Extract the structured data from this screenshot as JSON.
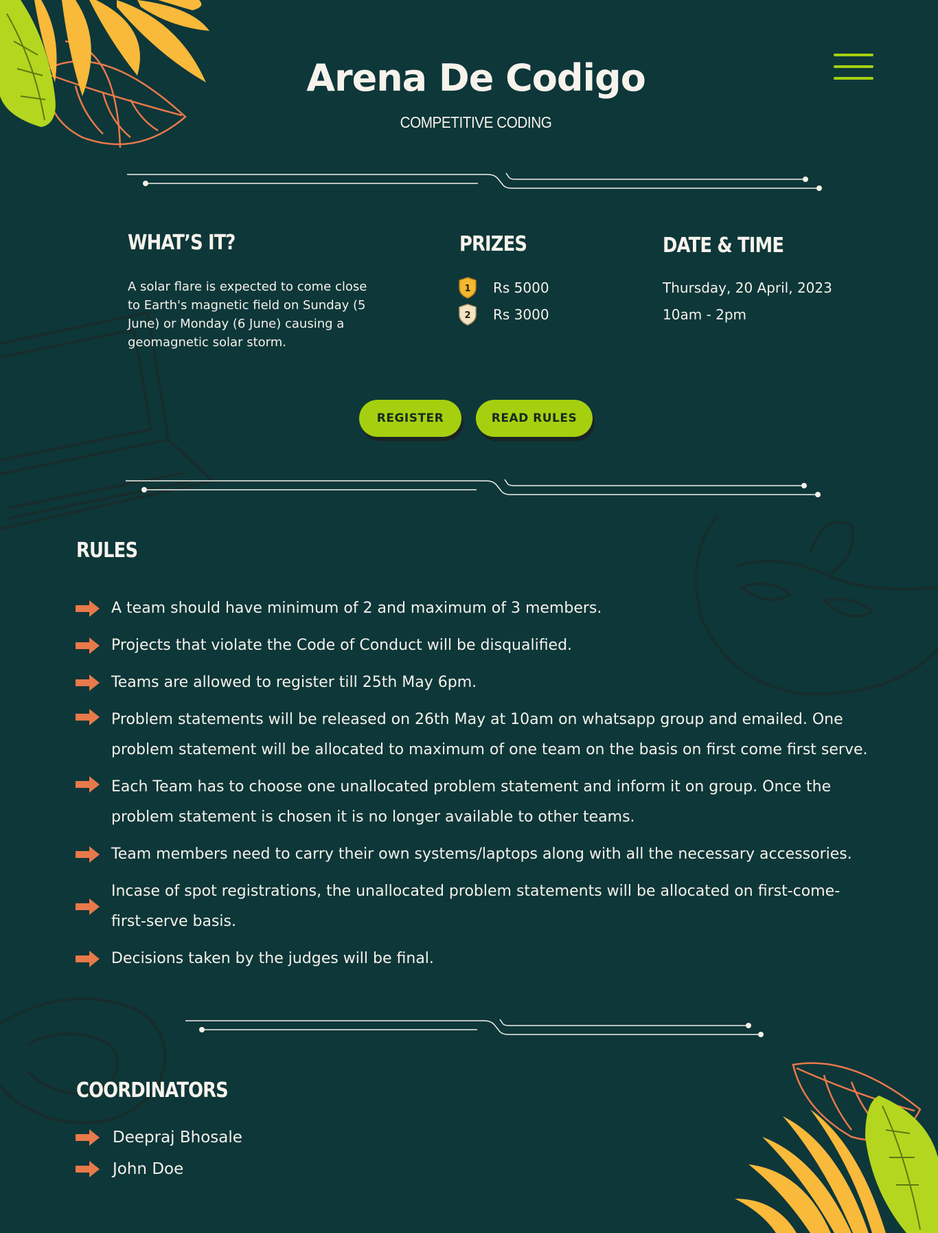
{
  "header": {
    "title": "Arena De Codigo",
    "subtitle": "COMPETITIVE CODING",
    "menu_icon": "hamburger-menu-icon"
  },
  "about": {
    "heading": "WHAT’S IT?",
    "text": "A solar flare is expected to come close to Earth's magnetic field on Sunday (5 June) or Monday (6 June) causing a geomagnetic solar storm."
  },
  "prizes": {
    "heading": "PRIZES",
    "items": [
      {
        "rank": "1",
        "amount": "Rs 5000",
        "badge_color": "#f5b731"
      },
      {
        "rank": "2",
        "amount": "Rs 3000",
        "badge_color": "#f3e4c4"
      }
    ]
  },
  "datetime": {
    "heading": "DATE & TIME",
    "date": "Thursday, 20 April, 2023",
    "time": "10am - 2pm"
  },
  "buttons": {
    "register": "REGISTER",
    "read_rules": "READ RULES"
  },
  "rules": {
    "heading": "RULES",
    "items": [
      "A team should have minimum of 2 and maximum of 3 members.",
      "Projects that violate the Code of Conduct will be disqualified.",
      "Teams are allowed to register till 25th May 6pm.",
      "Problem statements will be released on 26th May at 10am on whatsapp group and emailed. One problem statement will be allocated to maximum of one team on the basis on first come first serve.",
      "Each Team has to choose one unallocated problem statement and inform it on group. Once the problem statement is chosen it is no longer available to other teams.",
      "Team members need to carry their own systems/laptops along with all the necessary accessories.",
      "Incase of spot registrations, the unallocated problem statements will be allocated on first-come-first-serve basis.",
      "Decisions taken by the judges will be final."
    ]
  },
  "coordinators": {
    "heading": "COORDINATORS",
    "items": [
      "Deepraj Bhosale",
      "John Doe"
    ]
  },
  "colors": {
    "background": "#0e3739",
    "accent": "#a6cf0f",
    "arrow": "#e8794a",
    "leaf_yellow": "#f9b93a",
    "leaf_green": "#b4d61f"
  }
}
